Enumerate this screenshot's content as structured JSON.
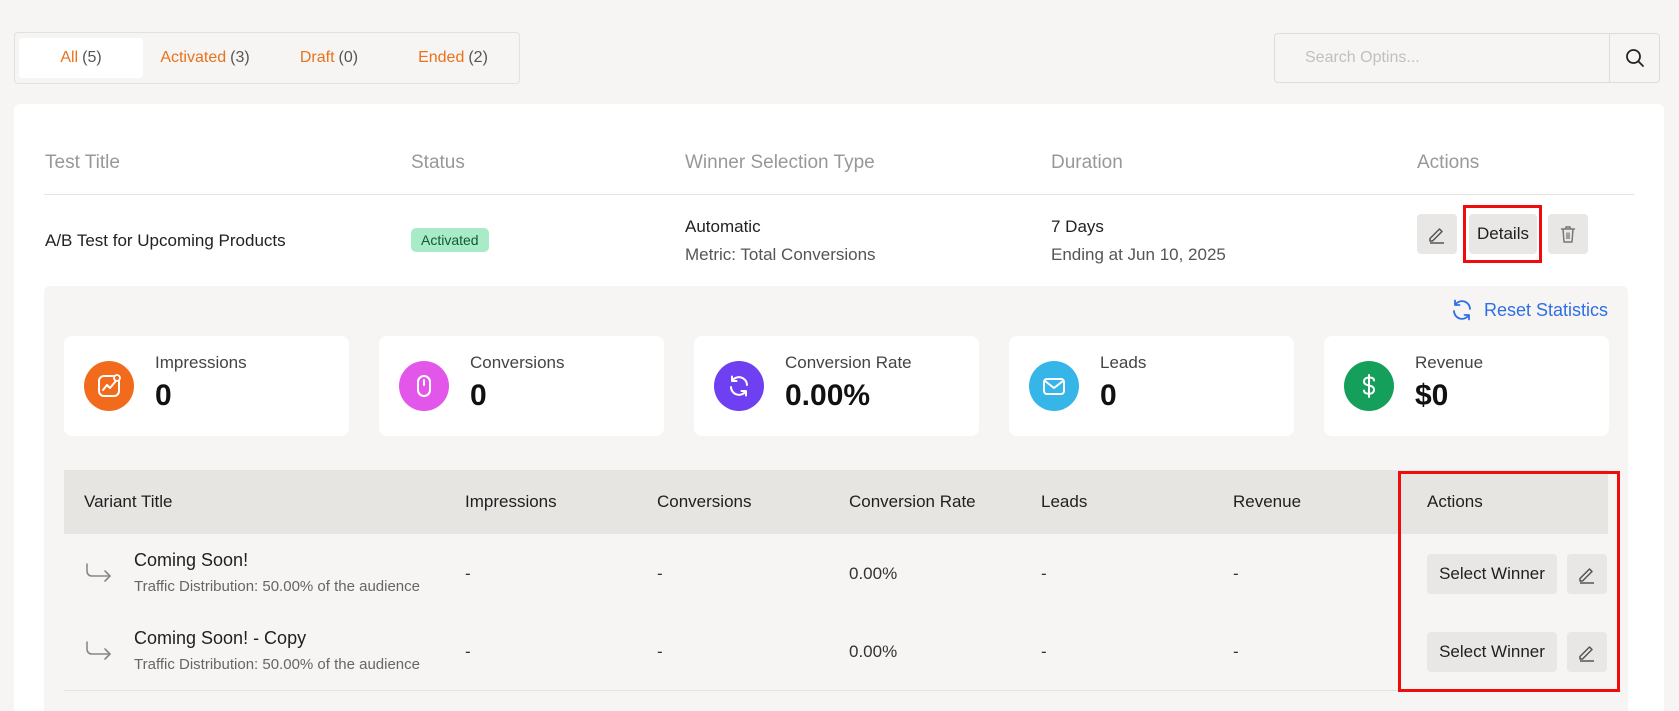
{
  "filters": [
    {
      "label": "All",
      "count": "(5)"
    },
    {
      "label": "Activated",
      "count": "(3)"
    },
    {
      "label": "Draft",
      "count": "(0)"
    },
    {
      "label": "Ended",
      "count": "(2)"
    }
  ],
  "search": {
    "placeholder": "Search Optins..."
  },
  "table": {
    "headers": {
      "title": "Test Title",
      "status": "Status",
      "winner_type": "Winner Selection Type",
      "duration": "Duration",
      "actions": "Actions"
    },
    "row": {
      "title": "A/B Test for Upcoming Products",
      "status": "Activated",
      "winner_type": "Automatic",
      "metric": "Metric: Total Conversions",
      "duration": "7 Days",
      "ending": "Ending at Jun 10, 2025",
      "details_label": "Details"
    }
  },
  "details": {
    "reset_label": "Reset Statistics",
    "stats": [
      {
        "label": "Impressions",
        "value": "0"
      },
      {
        "label": "Conversions",
        "value": "0"
      },
      {
        "label": "Conversion Rate",
        "value": "0.00%"
      },
      {
        "label": "Leads",
        "value": "0"
      },
      {
        "label": "Revenue",
        "value": "$0"
      }
    ],
    "variant_headers": {
      "title": "Variant Title",
      "impressions": "Impressions",
      "conversions": "Conversions",
      "rate": "Conversion Rate",
      "leads": "Leads",
      "revenue": "Revenue",
      "actions": "Actions"
    },
    "variants": [
      {
        "title": "Coming Soon!",
        "distribution": "Traffic Distribution: 50.00% of the audience",
        "impressions": "-",
        "conversions": "-",
        "rate": "0.00%",
        "leads": "-",
        "revenue": "-",
        "action_label": "Select Winner"
      },
      {
        "title": "Coming Soon! - Copy",
        "distribution": "Traffic Distribution: 50.00% of the audience",
        "impressions": "-",
        "conversions": "-",
        "rate": "0.00%",
        "leads": "-",
        "revenue": "-",
        "action_label": "Select Winner"
      }
    ]
  },
  "colors": {
    "accent_orange": "#e8731c",
    "link_blue": "#2f6fe3",
    "impressions_icon": "#f26b1d",
    "conversions_icon": "#e356ea",
    "rate_icon": "#6f3ff2",
    "leads_icon": "#36b6e8",
    "revenue_icon": "#14a05a",
    "highlight_red": "#ee0c0c"
  },
  "icons": [
    "search-icon",
    "edit-icon",
    "trash-icon",
    "refresh-icon",
    "chart-icon",
    "mouse-icon",
    "sync-icon",
    "mail-icon",
    "dollar-icon",
    "redirect-arrow-icon"
  ]
}
